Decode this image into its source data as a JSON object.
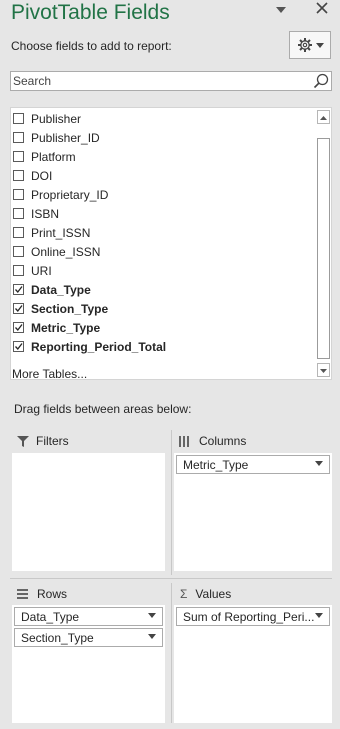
{
  "header": {
    "title": "PivotTable Fields",
    "choose_label": "Choose fields to add to report:"
  },
  "search": {
    "placeholder": "Search"
  },
  "fields": [
    {
      "label": "Publisher",
      "checked": false
    },
    {
      "label": "Publisher_ID",
      "checked": false
    },
    {
      "label": "Platform",
      "checked": false
    },
    {
      "label": "DOI",
      "checked": false
    },
    {
      "label": "Proprietary_ID",
      "checked": false
    },
    {
      "label": "ISBN",
      "checked": false
    },
    {
      "label": "Print_ISSN",
      "checked": false
    },
    {
      "label": "Online_ISSN",
      "checked": false
    },
    {
      "label": "URI",
      "checked": false
    },
    {
      "label": "Data_Type",
      "checked": true
    },
    {
      "label": "Section_Type",
      "checked": true
    },
    {
      "label": "Metric_Type",
      "checked": true
    },
    {
      "label": "Reporting_Period_Total",
      "checked": true
    }
  ],
  "more_tables": "More Tables...",
  "drag_label": "Drag fields between areas below:",
  "areas": {
    "filters": {
      "label": "Filters",
      "items": []
    },
    "columns": {
      "label": "Columns",
      "items": [
        "Metric_Type"
      ]
    },
    "rows": {
      "label": "Rows",
      "items": [
        "Data_Type",
        "Section_Type"
      ]
    },
    "values": {
      "label": "Values",
      "items": [
        "Sum of Reporting_Peri..."
      ]
    }
  },
  "icons": {
    "dropdown": "chevron-down-icon",
    "close": "close-icon",
    "gear": "gear-icon",
    "search": "search-icon"
  },
  "colors": {
    "title": "#217346",
    "panel_bg": "#e6e6e6"
  }
}
